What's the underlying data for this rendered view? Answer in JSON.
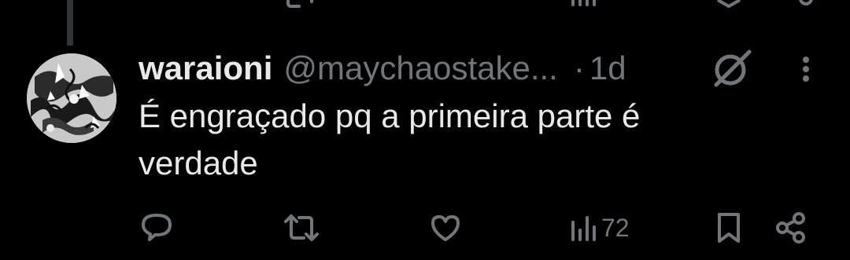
{
  "reply": {
    "author_name": "waraioni",
    "author_handle": "@maychaostake...",
    "separator": "·",
    "time": "1d",
    "text": "É engraçado pq a primeira parte é verdade"
  },
  "actions": {
    "views": "72"
  },
  "icons": [
    "reply-icon",
    "retweet-icon",
    "like-icon",
    "views-icon",
    "bookmark-icon",
    "share-icon",
    "grok-icon",
    "more-icon"
  ],
  "colors": {
    "background": "#000000",
    "text": "#e7e9ea",
    "muted": "#71767b"
  }
}
